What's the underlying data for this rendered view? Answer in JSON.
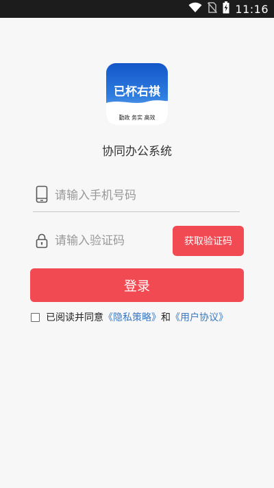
{
  "status_bar": {
    "time": "11:16",
    "icons": [
      "wifi-icon",
      "no-sim-icon",
      "battery-charging-icon"
    ]
  },
  "app": {
    "logo_text": "已杯右祺",
    "logo_subtext": "勤政 务实 高效",
    "title": "协同办公系统"
  },
  "login_form": {
    "phone_placeholder": "请输入手机号码",
    "code_placeholder": "请输入验证码",
    "get_code_label": "获取验证码",
    "login_label": "登录"
  },
  "agreement": {
    "checked": false,
    "prefix": "已阅读并同意",
    "privacy_link": "《隐私策略》",
    "and": "和",
    "user_link": "《用户协议》"
  },
  "colors": {
    "accent": "#f24a52",
    "link": "#3a78c4",
    "background": "#f7f7f7",
    "status_bar": "#1c1c1c"
  }
}
